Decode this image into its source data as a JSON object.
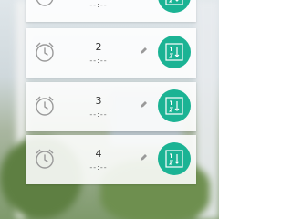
{
  "colors": {
    "accent": "#1bb394",
    "card_bg": "#ffffff",
    "icon_gray": "#9a9a9a"
  },
  "alarms": [
    {
      "label": "",
      "time": "--:--",
      "icon": "alarm-clock-icon"
    },
    {
      "label": "2",
      "time": "--:--",
      "icon": "alarm-clock-icon"
    },
    {
      "label": "3",
      "time": "--:--",
      "icon": "alarm-clock-icon"
    },
    {
      "label": "4",
      "time": "--:--",
      "icon": "alarm-clock-icon"
    }
  ],
  "action_icon": "sort-az-icon",
  "edit_icon": "pencil-icon"
}
